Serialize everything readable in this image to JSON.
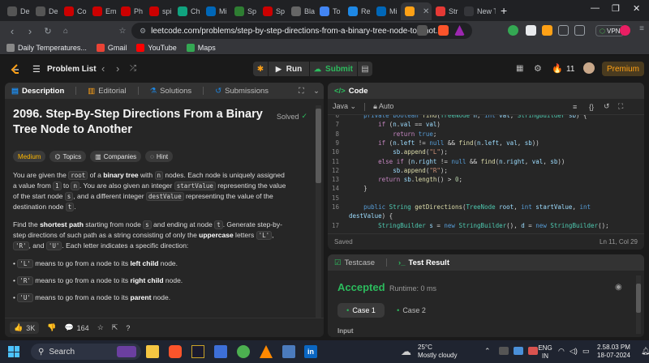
{
  "browser": {
    "tabs": [
      {
        "label": "De",
        "color": "#555"
      },
      {
        "label": "De",
        "color": "#555"
      },
      {
        "label": "Co",
        "color": "#cc0000"
      },
      {
        "label": "Em",
        "color": "#cc0000"
      },
      {
        "label": "Ph",
        "color": "#cc0000"
      },
      {
        "label": "spi",
        "color": "#cc0000"
      },
      {
        "label": "Ch",
        "color": "#10a37f"
      },
      {
        "label": "Mi",
        "color": "#0067b8"
      },
      {
        "label": "Sp",
        "color": "#2e7d32"
      },
      {
        "label": "Sp",
        "color": "#cc0000"
      },
      {
        "label": "Bla",
        "color": "#666"
      },
      {
        "label": "To",
        "color": "#4285f4"
      },
      {
        "label": "Re",
        "color": "#1e88e5"
      },
      {
        "label": "Mi",
        "color": "#0067b8"
      },
      {
        "label": "",
        "color": "#ffa116"
      },
      {
        "label": "Str",
        "color": "#e53935"
      },
      {
        "label": "New To",
        "color": "#35363a"
      }
    ],
    "url": "leetcode.com/problems/step-by-step-directions-from-a-binary-tree-node-to-anot...",
    "vpn_label": "VPN",
    "bookmarks": [
      {
        "label": "Daily Temperatures...",
        "color": "#888"
      },
      {
        "label": "Gmail",
        "color": "#ea4335"
      },
      {
        "label": "YouTube",
        "color": "#ff0000"
      },
      {
        "label": "Maps",
        "color": "#34a853"
      }
    ]
  },
  "header": {
    "problem_list_label": "Problem List",
    "run_label": "Run",
    "submit_label": "Submit",
    "streak_count": "11",
    "premium_label": "Premium"
  },
  "description_panel": {
    "tabs": [
      "Description",
      "Editorial",
      "Solutions",
      "Submissions"
    ],
    "title_line1": "2096. Step-By-Step Directions From a Binary",
    "title_line2": "Tree Node to Another",
    "solved_label": "Solved",
    "chips": [
      "Medium",
      "Topics",
      "Companies",
      "Hint"
    ],
    "para1": [
      {
        "t": "You are given the "
      },
      {
        "c": "root"
      },
      {
        "t": " of a "
      },
      {
        "b": "binary tree"
      },
      {
        "t": " with "
      },
      {
        "c": "n"
      },
      {
        "t": " nodes. Each node is uniquely assigned a value from "
      },
      {
        "c": "1"
      },
      {
        "t": " to "
      },
      {
        "c": "n"
      },
      {
        "t": ". You are also given an integer "
      },
      {
        "c": "startValue"
      },
      {
        "t": " representing the value of the start node "
      },
      {
        "c": "s"
      },
      {
        "t": ", and a different integer "
      },
      {
        "c": "destValue"
      },
      {
        "t": " representing the value of the destination node "
      },
      {
        "c": "t"
      },
      {
        "t": "."
      }
    ],
    "para2": [
      {
        "t": "Find the "
      },
      {
        "b": "shortest path"
      },
      {
        "t": " starting from node "
      },
      {
        "c": "s"
      },
      {
        "t": " and ending at node "
      },
      {
        "c": "t"
      },
      {
        "t": ". Generate step-by-step directions of such path as a string consisting of only the "
      },
      {
        "b": "uppercase"
      },
      {
        "t": " letters "
      },
      {
        "c": "'L'"
      },
      {
        "t": ", "
      },
      {
        "c": "'R'"
      },
      {
        "t": ", and "
      },
      {
        "c": "'U'"
      },
      {
        "t": ". Each letter indicates a specific direction:"
      }
    ],
    "bullets": [
      [
        {
          "c": "'L'"
        },
        {
          "t": " means to go from a node to its "
        },
        {
          "b": "left child"
        },
        {
          "t": " node."
        }
      ],
      [
        {
          "c": "'R'"
        },
        {
          "t": " means to go from a node to its "
        },
        {
          "b": "right child"
        },
        {
          "t": " node."
        }
      ],
      [
        {
          "c": "'U'"
        },
        {
          "t": " means to go from a node to its "
        },
        {
          "b": "parent"
        },
        {
          "t": " node."
        }
      ]
    ],
    "likes": "3K",
    "comments": "164"
  },
  "code_panel": {
    "title": "Code",
    "language": "Java",
    "mode": "Auto",
    "status_left": "Saved",
    "status_right": "Ln 11, Col 29",
    "lines": [
      {
        "n": "6",
        "html": "    <span class='kw'>private</span> <span class='kw'>boolean</span> <span class='fn'>find</span><span class='plain'>(</span><span class='ty'>TreeNode</span> <span class='src'>n</span><span class='plain'>,</span> <span class='kw'>int</span> <span class='src'>val</span><span class='plain'>,</span> <span class='ty'>StringBuilder</span> <span class='src'>sb</span><span class='plain'>) {</span>"
      },
      {
        "n": "7",
        "html": "        <span class='kw2'>if</span> <span class='plain'>(</span><span class='src'>n</span><span class='plain'>.</span><span class='src'>val</span> <span class='plain'>==</span> <span class='src'>val</span><span class='plain'>)</span>"
      },
      {
        "n": "8",
        "html": "            <span class='kw2'>return</span> <span class='kw'>true</span><span class='plain'>;</span>"
      },
      {
        "n": "9",
        "html": "        <span class='kw2'>if</span> <span class='plain'>(</span><span class='src'>n</span><span class='plain'>.</span><span class='src'>left</span> <span class='plain'>!=</span> <span class='kw'>null</span> <span class='plain'>&amp;&amp;</span> <span class='fn'>find</span><span class='plain'>(</span><span class='src'>n</span><span class='plain'>.</span><span class='src'>left</span><span class='plain'>,</span> <span class='src'>val</span><span class='plain'>,</span> <span class='src'>sb</span><span class='plain'>))</span>"
      },
      {
        "n": "10",
        "html": "            <span class='src'>sb</span><span class='plain'>.</span><span class='fn'>append</span><span class='plain'>(</span><span class='str'>\"L\"</span><span class='plain'>);</span>"
      },
      {
        "n": "11",
        "html": "        <span class='kw2'>else</span> <span class='kw2'>if</span> <span class='plain'>(</span><span class='src'>n</span><span class='plain'>.</span><span class='src'>right</span> <span class='plain'>!=</span> <span class='kw'>null</span> <span class='plain'>&amp;&amp;</span> <span class='fn'>find</span><span class='plain'>(</span><span class='src'>n</span><span class='plain'>.</span><span class='src'>right</span><span class='plain'>,</span> <span class='src'>val</span><span class='plain'>,</span> <span class='src'>sb</span><span class='plain'>))</span>"
      },
      {
        "n": "12",
        "html": "            <span class='src'>sb</span><span class='plain'>.</span><span class='fn'>append</span><span class='plain'>(</span><span class='str'>\"R\"</span><span class='plain'>);</span>"
      },
      {
        "n": "13",
        "html": "        <span class='kw2'>return</span> <span class='src'>sb</span><span class='plain'>.</span><span class='fn'>length</span><span class='plain'>() &gt;</span> <span class='num'>0</span><span class='plain'>;</span>"
      },
      {
        "n": "14",
        "html": "    <span class='plain'>}</span>"
      },
      {
        "n": "15",
        "html": ""
      },
      {
        "n": "16",
        "html": "    <span class='kw'>public</span> <span class='ty'>String</span> <span class='fn'>getDirections</span><span class='plain'>(</span><span class='ty'>TreeNode</span> <span class='src'>root</span><span class='plain'>,</span> <span class='kw'>int</span> <span class='src'>startValue</span><span class='plain'>,</span> <span class='kw'>int</span>"
      },
      {
        "n": "",
        "html": "<span class='src'>destValue</span><span class='plain'>) {</span>"
      },
      {
        "n": "17",
        "html": "        <span class='ty'>StringBuilder</span> <span class='src'>s</span> <span class='plain'>=</span> <span class='kw'>new</span> <span class='ty'>StringBuilder</span><span class='plain'>(),</span> <span class='src'>d</span> <span class='plain'>=</span> <span class='kw'>new</span> <span class='ty'>StringBuilder</span><span class='plain'>();</span>"
      }
    ]
  },
  "result_panel": {
    "tabs": [
      "Testcase",
      "Test Result"
    ],
    "status": "Accepted",
    "runtime": "Runtime: 0 ms",
    "cases": [
      "Case 1",
      "Case 2"
    ],
    "input_label": "Input"
  },
  "taskbar": {
    "search_label": "Search",
    "weather_temp": "25°C",
    "weather_desc": "Mostly cloudy",
    "lang_line1": "ENG",
    "lang_line2": "IN",
    "time": "2.58.03 PM",
    "date": "18-07-2024"
  },
  "colors": {
    "accent_orange": "#ffa116",
    "accepted_green": "#2cbb5d",
    "medium_yellow": "#ffb800"
  }
}
